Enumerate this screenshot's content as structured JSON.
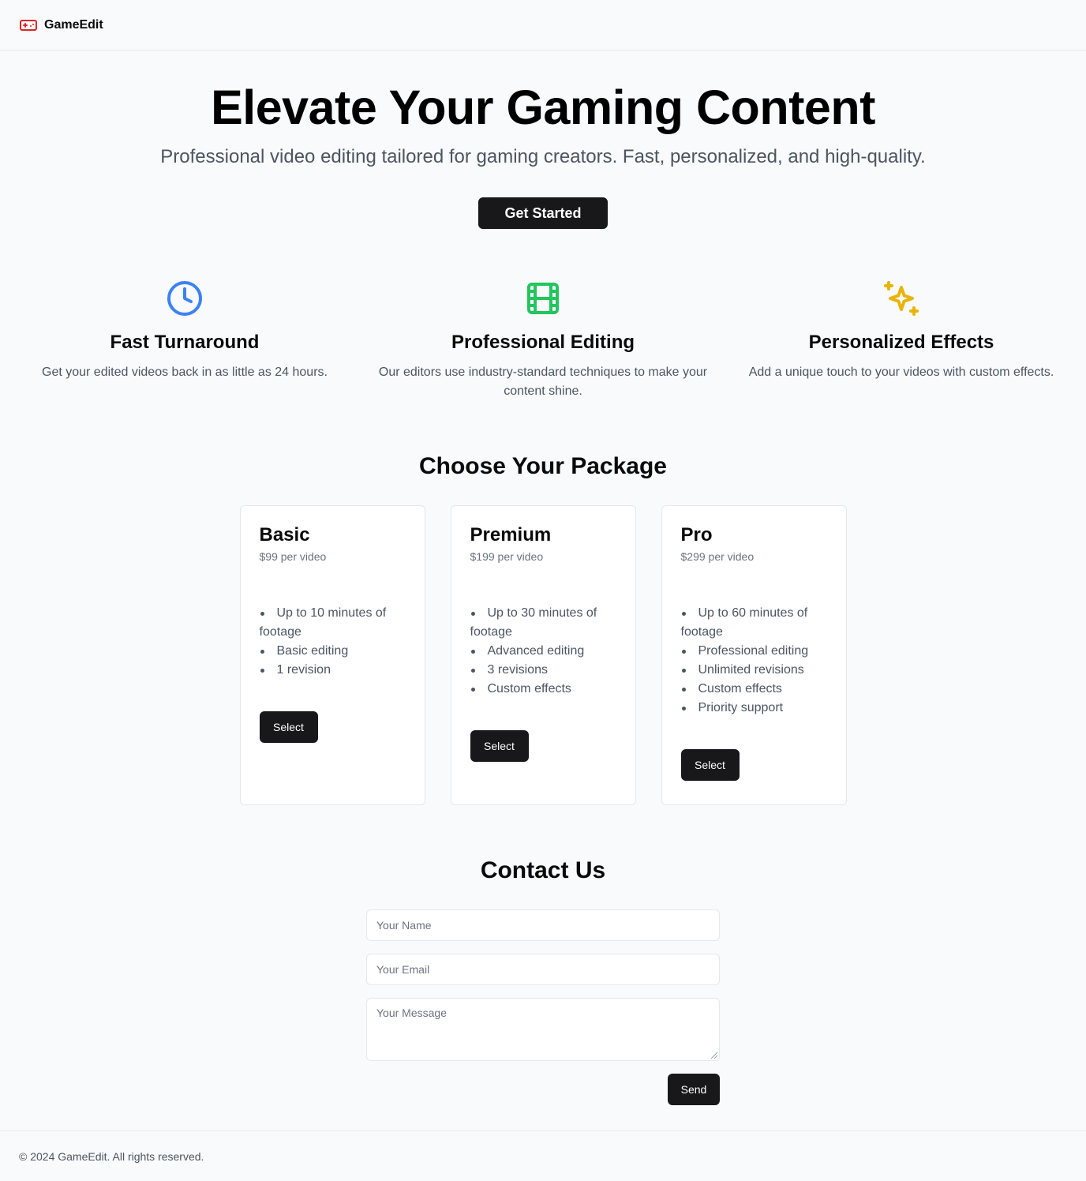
{
  "header": {
    "brand_name": "GameEdit",
    "brand_icon": "gamepad-icon",
    "brand_color": "#dc2626"
  },
  "hero": {
    "title": "Elevate Your Gaming Content",
    "subtitle": "Professional video editing tailored for gaming creators. Fast, personalized, and high-quality.",
    "cta_label": "Get Started"
  },
  "features": [
    {
      "icon": "clock-icon",
      "color": "#3b82f6",
      "title": "Fast Turnaround",
      "description": "Get your edited videos back in as little as 24 hours."
    },
    {
      "icon": "film-icon",
      "color": "#22c55e",
      "title": "Professional Editing",
      "description": "Our editors use industry-standard techniques to make your content shine."
    },
    {
      "icon": "sparkles-icon",
      "color": "#eab308",
      "title": "Personalized Effects",
      "description": "Add a unique touch to your videos with custom effects."
    }
  ],
  "packages": {
    "title": "Choose Your Package",
    "items": [
      {
        "name": "Basic",
        "price": "$99 per video",
        "features": [
          "Up to 10 minutes of footage",
          "Basic editing",
          "1 revision"
        ],
        "button_label": "Select"
      },
      {
        "name": "Premium",
        "price": "$199 per video",
        "features": [
          "Up to 30 minutes of footage",
          "Advanced editing",
          "3 revisions",
          "Custom effects"
        ],
        "button_label": "Select"
      },
      {
        "name": "Pro",
        "price": "$299 per video",
        "features": [
          "Up to 60 minutes of footage",
          "Professional editing",
          "Unlimited revisions",
          "Custom effects",
          "Priority support"
        ],
        "button_label": "Select"
      }
    ]
  },
  "contact": {
    "title": "Contact Us",
    "name_placeholder": "Your Name",
    "email_placeholder": "Your Email",
    "message_placeholder": "Your Message",
    "send_label": "Send"
  },
  "footer": {
    "text": "© 2024 GameEdit. All rights reserved."
  }
}
